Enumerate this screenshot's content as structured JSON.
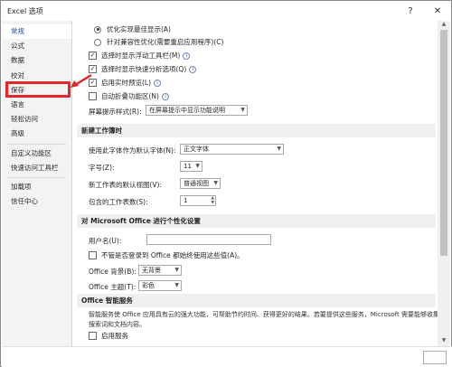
{
  "window": {
    "title": "Excel 选项",
    "help_icon": "?",
    "close_icon": "✕"
  },
  "sidebar": {
    "items": [
      {
        "label": "常规"
      },
      {
        "label": "公式"
      },
      {
        "label": "数据"
      },
      {
        "label": "校对"
      },
      {
        "label": "保存"
      },
      {
        "label": "语言"
      },
      {
        "label": "轻松访问"
      },
      {
        "label": "高级"
      },
      {
        "label": "自定义功能区"
      },
      {
        "label": "快速访问工具栏"
      },
      {
        "label": "加载项"
      },
      {
        "label": "信任中心"
      }
    ]
  },
  "ui_options": {
    "radio_optimize_display": "优化实现最佳显示(A)",
    "radio_compat": "针对兼容性优化(需要重启应用程序)(C)",
    "check_mini_toolbar": "选择时显示浮动工具栏(M)",
    "check_quick_analysis": "选择时显示快速分析选项(Q)",
    "check_live_preview": "启用实时预览(L)",
    "check_collapse_ribbon": "自动折叠功能区(N)",
    "screentip_label": "屏幕提示样式(R):",
    "screentip_value": "在屏幕提示中显示功能说明"
  },
  "new_workbook": {
    "header": "新建工作簿时",
    "font_label": "使用此字体作为默认字体(N):",
    "font_value": "正文字体",
    "size_label": "字号(Z):",
    "size_value": "11",
    "view_label": "新工作表的默认视图(V):",
    "view_value": "普通视图",
    "sheets_label": "包含的工作表数(S):",
    "sheets_value": "1"
  },
  "personalize": {
    "header": "对 Microsoft Office 进行个性化设置",
    "username_label": "用户名(U):",
    "username_value": "",
    "always_use_label": "不管是否登录到 Office 都始终使用这些值(A)。",
    "background_label": "Office 背景(B):",
    "background_value": "无背景",
    "theme_label": "Office 主题(T):",
    "theme_value": "彩色"
  },
  "smart_services": {
    "header": "Office 智能服务",
    "description": "智能服务使 Office 应用具有云的强大功能，可帮助节约时间、获得更好的结果。若要提供这些服务，Microsoft 需要能够收集搜索词和文档内容。",
    "enable_label": "启用服务"
  },
  "colors": {
    "accent": "#1b4e9b",
    "highlight": "#e4262a"
  }
}
